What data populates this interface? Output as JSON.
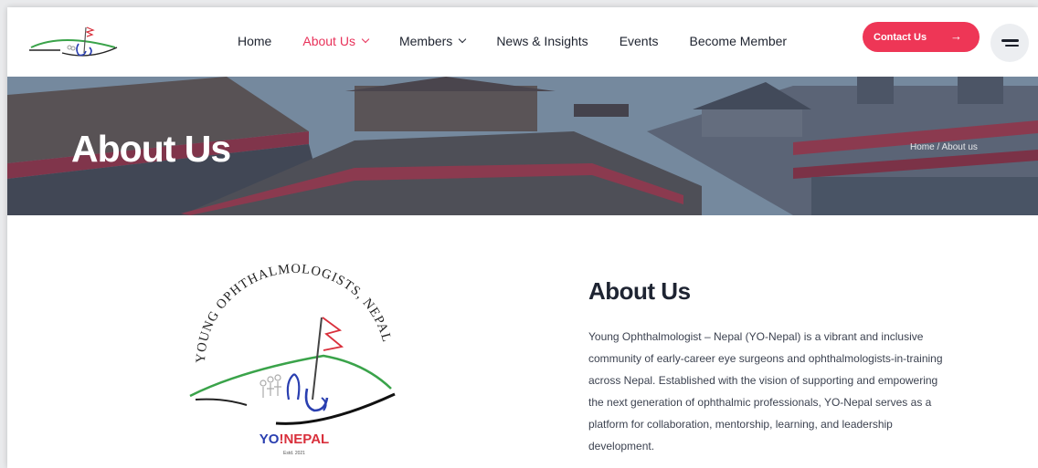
{
  "header": {
    "nav": [
      {
        "label": "Home",
        "active": false,
        "dropdown": false
      },
      {
        "label": "About Us",
        "active": true,
        "dropdown": true
      },
      {
        "label": "Members",
        "active": false,
        "dropdown": true
      },
      {
        "label": "News & Insights",
        "active": false,
        "dropdown": false
      },
      {
        "label": "Events",
        "active": false,
        "dropdown": false
      },
      {
        "label": "Become Member",
        "active": false,
        "dropdown": false
      }
    ],
    "contact_label": "Contact Us",
    "contact_arrow": "→"
  },
  "banner": {
    "title": "About Us",
    "breadcrumb": "Home / About us"
  },
  "emblem": {
    "arc_text": "YOUNG OPHTHALMOLOGISTS, NEPAL",
    "brand_yo": "YO",
    "brand_bang": "!",
    "brand_nepal": "NEPAL",
    "est": "Estd. 2021"
  },
  "about": {
    "title": "About Us",
    "body": "Young Ophthalmologist – Nepal (YO-Nepal) is a vibrant and inclusive community of early-career eye surgeons and ophthalmologists-in-training across Nepal. Established with the vision of supporting and empowering the next generation of ophthalmic professionals, YO-Nepal serves as a platform for collaboration, mentorship, learning, and leadership development."
  },
  "colors": {
    "accent": "#ee3656",
    "active_nav": "#e8325a",
    "logo_green": "#3aa34a",
    "logo_blue": "#2a3fb0",
    "logo_red": "#d9303c"
  },
  "icons": [
    "chevron-down-icon",
    "arrow-right-icon",
    "hamburger-menu-icon"
  ]
}
